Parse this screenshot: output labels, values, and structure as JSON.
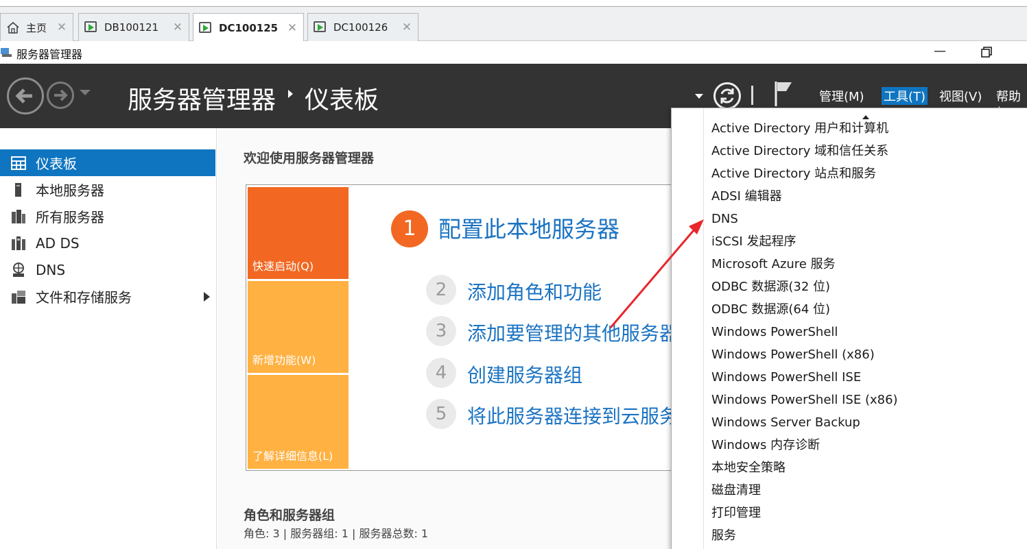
{
  "tabs": [
    {
      "label": "主页",
      "icon": "home-icon",
      "active": false
    },
    {
      "label": "DB100121",
      "icon": "vm-icon",
      "active": false
    },
    {
      "label": "DC100125",
      "icon": "vm-icon",
      "active": true
    },
    {
      "label": "DC100126",
      "icon": "vm-icon",
      "active": false
    }
  ],
  "window": {
    "title": "服务器管理器"
  },
  "header": {
    "breadcrumb_root": "服务器管理器",
    "breadcrumb_page": "仪表板",
    "menus": [
      "管理(M)",
      "工具(T)",
      "视图(V)",
      "帮助("
    ],
    "selected_menu": "工具(T)"
  },
  "sidebar": {
    "items": [
      {
        "label": "仪表板",
        "icon": "dashboard-icon",
        "active": true
      },
      {
        "label": "本地服务器",
        "icon": "server-icon"
      },
      {
        "label": "所有服务器",
        "icon": "servers-icon"
      },
      {
        "label": "AD DS",
        "icon": "ad-ds-icon"
      },
      {
        "label": "DNS",
        "icon": "dns-icon"
      },
      {
        "label": "文件和存储服务",
        "icon": "file-storage-icon",
        "has_submenu": true
      }
    ]
  },
  "main": {
    "welcome": "欢迎使用服务器管理器",
    "tiles": [
      "快速启动(Q)",
      "新增功能(W)",
      "了解详细信息(L)"
    ],
    "steps": [
      {
        "num": "1",
        "label": "配置此本地服务器"
      },
      {
        "num": "2",
        "label": "添加角色和功能"
      },
      {
        "num": "3",
        "label": "添加要管理的其他服务器"
      },
      {
        "num": "4",
        "label": "创建服务器组"
      },
      {
        "num": "5",
        "label": "将此服务器连接到云服务"
      }
    ],
    "roles_title": "角色和服务器组",
    "roles_summary": "角色: 3 | 服务器组: 1 | 服务器总数: 1"
  },
  "tools_menu": {
    "items": [
      "Active Directory 用户和计算机",
      "Active Directory 域和信任关系",
      "Active Directory 站点和服务",
      "ADSI 编辑器",
      "DNS",
      "iSCSI 发起程序",
      "Microsoft Azure 服务",
      "ODBC 数据源(32 位)",
      "ODBC 数据源(64 位)",
      "Windows PowerShell",
      "Windows PowerShell (x86)",
      "Windows PowerShell ISE",
      "Windows PowerShell ISE (x86)",
      "Windows Server Backup",
      "Windows 内存诊断",
      "本地安全策略",
      "磁盘清理",
      "打印管理",
      "服务"
    ]
  },
  "colors": {
    "accent": "#0f75c0",
    "header_bg": "#333333",
    "tile_orange": "#f26822",
    "tile_yellow": "#ffb142",
    "link": "#1b73c2",
    "annotation_arrow": "#e8262b"
  }
}
